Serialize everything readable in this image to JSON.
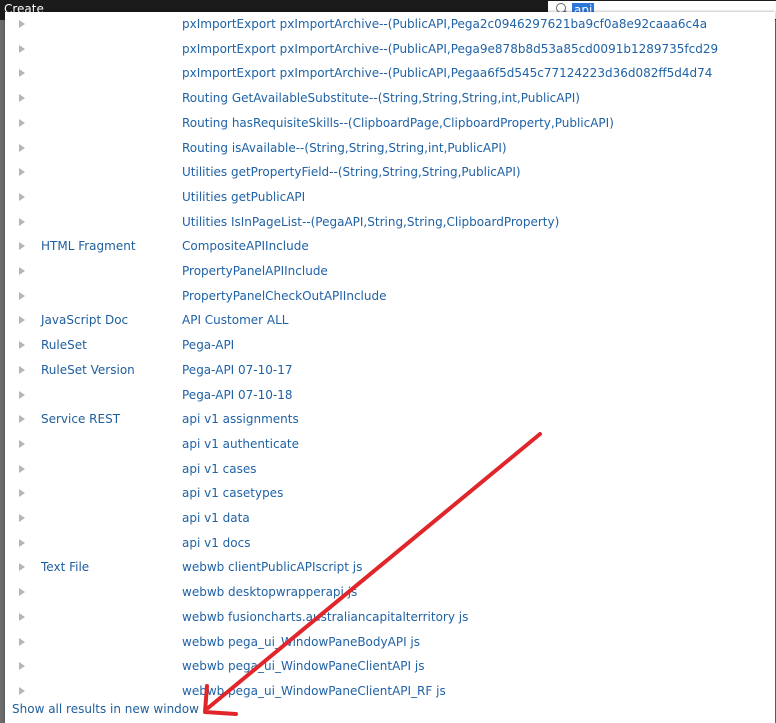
{
  "header": {
    "create_label": "Create"
  },
  "search": {
    "query": "api",
    "icon": "search-icon"
  },
  "rows": [
    {
      "category": "",
      "result": "pxImportExport pxImportArchive--(PublicAPI,Pega2c0946297621ba9cf0a8e92caaa6c4a"
    },
    {
      "category": "",
      "result": "pxImportExport pxImportArchive--(PublicAPI,Pega9e878b8d53a85cd0091b1289735fcd29"
    },
    {
      "category": "",
      "result": "pxImportExport pxImportArchive--(PublicAPI,Pegaa6f5d545c77124223d36d082ff5d4d74"
    },
    {
      "category": "",
      "result": "Routing GetAvailableSubstitute--(String,String,String,int,PublicAPI)"
    },
    {
      "category": "",
      "result": "Routing hasRequisiteSkills--(ClipboardPage,ClipboardProperty,PublicAPI)"
    },
    {
      "category": "",
      "result": "Routing isAvailable--(String,String,String,int,PublicAPI)"
    },
    {
      "category": "",
      "result": "Utilities getPropertyField--(String,String,String,PublicAPI)"
    },
    {
      "category": "",
      "result": "Utilities getPublicAPI"
    },
    {
      "category": "",
      "result": "Utilities IsInPageList--(PegaAPI,String,String,ClipboardProperty)"
    },
    {
      "category": "HTML Fragment",
      "result": "CompositeAPIInclude"
    },
    {
      "category": "",
      "result": "PropertyPanelAPIInclude"
    },
    {
      "category": "",
      "result": "PropertyPanelCheckOutAPIInclude"
    },
    {
      "category": "JavaScript Doc",
      "result": "API Customer ALL"
    },
    {
      "category": "RuleSet",
      "result": "Pega-API"
    },
    {
      "category": "RuleSet Version",
      "result": "Pega-API 07-10-17"
    },
    {
      "category": "",
      "result": "Pega-API 07-10-18"
    },
    {
      "category": "Service REST",
      "result": "api v1 assignments"
    },
    {
      "category": "",
      "result": "api v1 authenticate"
    },
    {
      "category": "",
      "result": "api v1 cases"
    },
    {
      "category": "",
      "result": "api v1 casetypes"
    },
    {
      "category": "",
      "result": "api v1 data"
    },
    {
      "category": "",
      "result": "api v1 docs"
    },
    {
      "category": "Text File",
      "result": "webwb clientPublicAPIscript js"
    },
    {
      "category": "",
      "result": "webwb desktopwrapperapi js"
    },
    {
      "category": "",
      "result": "webwb fusioncharts.australiancapitalterritory js"
    },
    {
      "category": "",
      "result": "webwb pega_ui_WindowPaneBodyAPI js"
    },
    {
      "category": "",
      "result": "webwb pega_ui_WindowPaneClientAPI js"
    },
    {
      "category": "",
      "result": "webwb pega_ui_WindowPaneClientAPI_RF js"
    }
  ],
  "footer": {
    "show_all_label": "Show all results in new window"
  },
  "colors": {
    "link": "#1f62a6",
    "annotation_arrow": "#e0262b",
    "selection": "#2b77d9"
  }
}
